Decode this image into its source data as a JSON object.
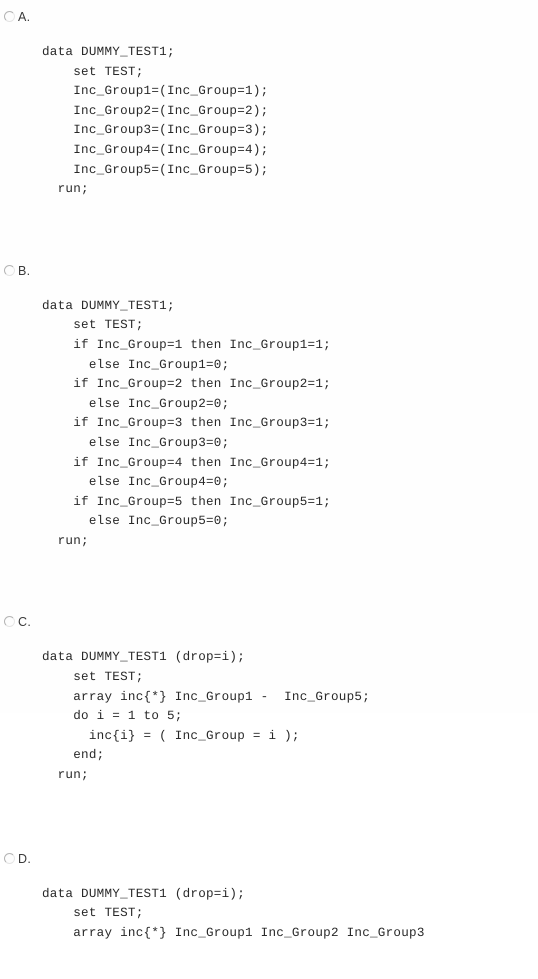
{
  "question": {
    "type": "multiple-choice-radio-list",
    "background_color": "#fefefe",
    "text_color": "#282828",
    "options": [
      {
        "letter": "A.",
        "radio_name": "radio-option-a",
        "selected": false,
        "code": "data DUMMY_TEST1;\n    set TEST;\n    Inc_Group1=(Inc_Group=1);\n    Inc_Group2=(Inc_Group=2);\n    Inc_Group3=(Inc_Group=3);\n    Inc_Group4=(Inc_Group=4);\n    Inc_Group5=(Inc_Group=5);\n  run;"
      },
      {
        "letter": "B.",
        "radio_name": "radio-option-b",
        "selected": false,
        "code": "data DUMMY_TEST1;\n    set TEST;\n    if Inc_Group=1 then Inc_Group1=1;\n      else Inc_Group1=0;\n    if Inc_Group=2 then Inc_Group2=1;\n      else Inc_Group2=0;\n    if Inc_Group=3 then Inc_Group3=1;\n      else Inc_Group3=0;\n    if Inc_Group=4 then Inc_Group4=1;\n      else Inc_Group4=0;\n    if Inc_Group=5 then Inc_Group5=1;\n      else Inc_Group5=0;\n  run;"
      },
      {
        "letter": "C.",
        "radio_name": "radio-option-c",
        "selected": false,
        "code": "data DUMMY_TEST1 (drop=i);\n    set TEST;\n    array inc{*} Inc_Group1 -  Inc_Group5;\n    do i = 1 to 5;\n      inc{i} = ( Inc_Group = i );\n    end;\n  run;"
      },
      {
        "letter": "D.",
        "radio_name": "radio-option-d",
        "selected": false,
        "code": "data DUMMY_TEST1 (drop=i);\n    set TEST;\n    array inc{*} Inc_Group1 Inc_Group2 Inc_Group3"
      }
    ]
  }
}
